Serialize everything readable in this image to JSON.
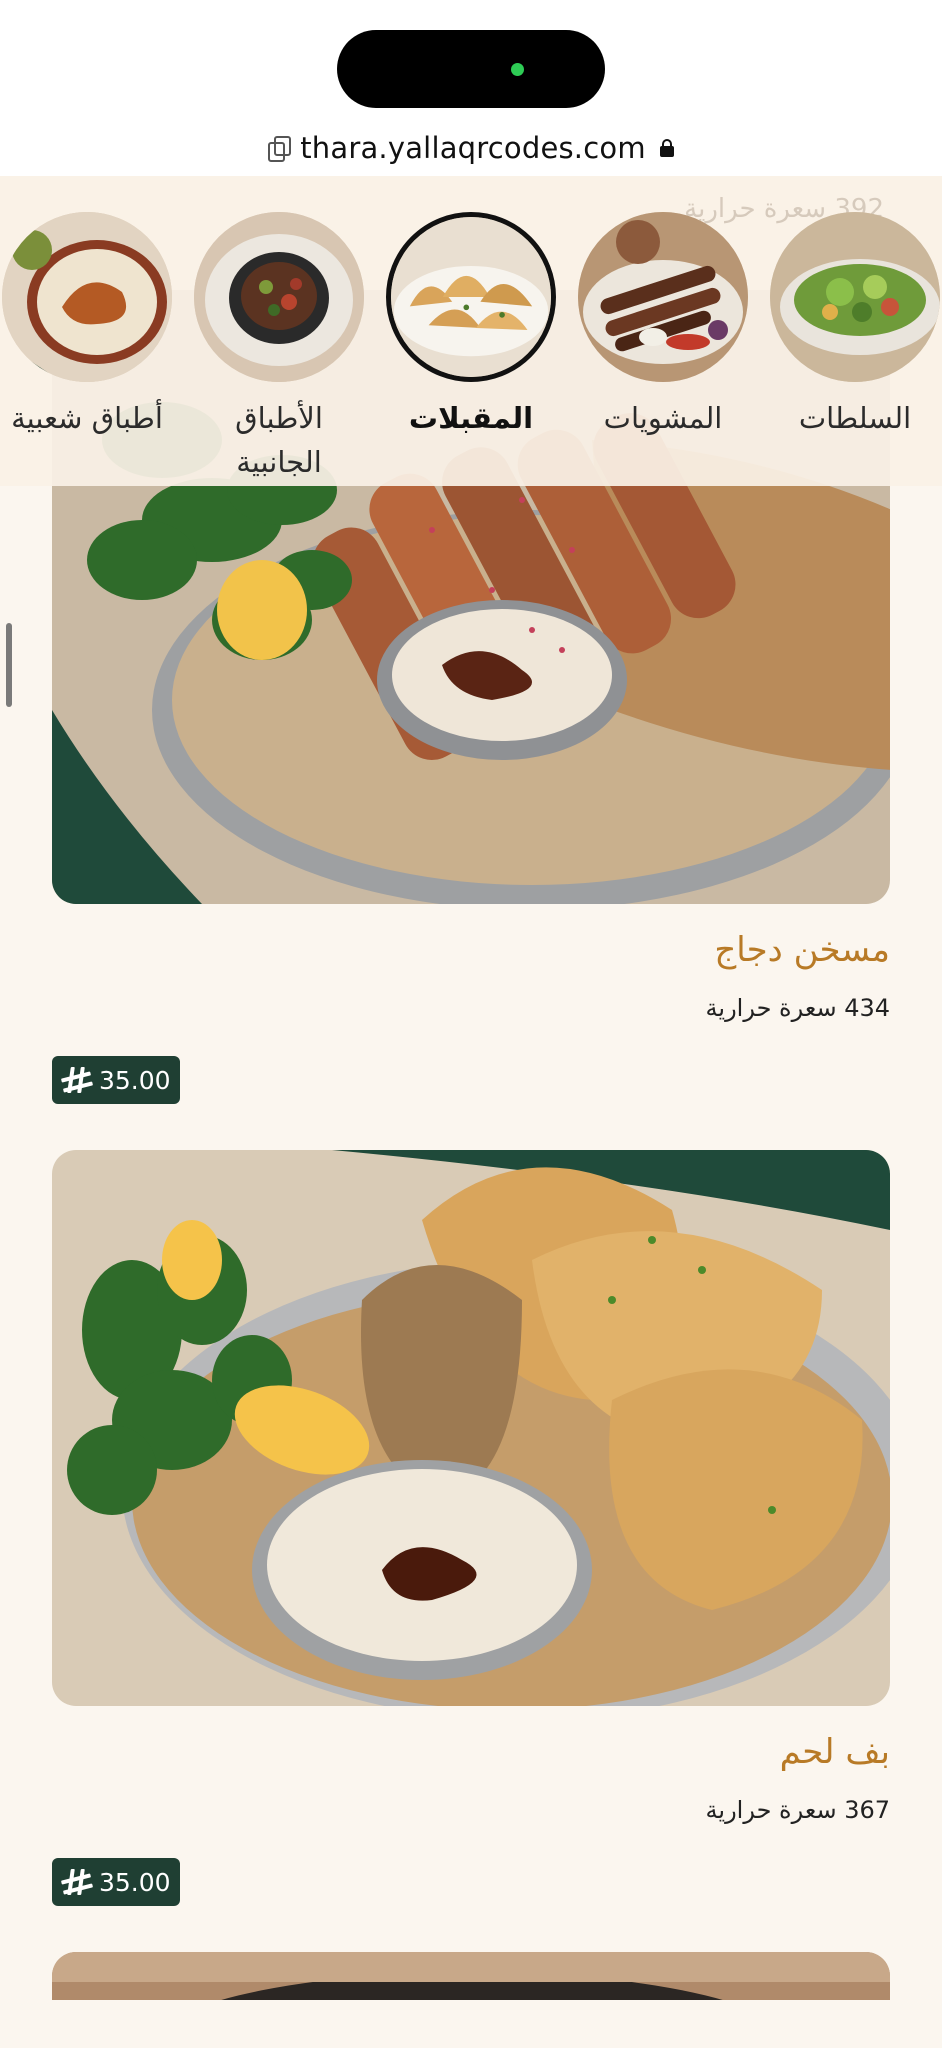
{
  "browser": {
    "url": "thara.yallaqrcodes.com",
    "copy_icon": "copy-icon",
    "lock_icon": "lock-icon"
  },
  "categories": [
    {
      "label": "السلطات",
      "icon": "salad-plate-image",
      "active": false
    },
    {
      "label": "المشويات",
      "icon": "grill-plate-image",
      "active": false
    },
    {
      "label": "المقبلات",
      "icon": "appetizers-plate-image",
      "active": true
    },
    {
      "label": "الأطباق الجانبية",
      "icon": "side-dish-image",
      "active": false
    },
    {
      "label": "أطباق شعبية",
      "icon": "popular-dish-image",
      "active": false
    }
  ],
  "ghost_calories": "392 سعرة حرارية",
  "items": [
    {
      "name": "مسخن دجاج",
      "calories": "434 سعرة حرارية",
      "price": "35.00"
    },
    {
      "name": "بف لحم",
      "calories": "367 سعرة حرارية",
      "price": "35.00"
    }
  ],
  "colors": {
    "accent_name": "#b87a26",
    "price_bg": "#1f3f33",
    "page_bg": "#fbf6ef"
  }
}
